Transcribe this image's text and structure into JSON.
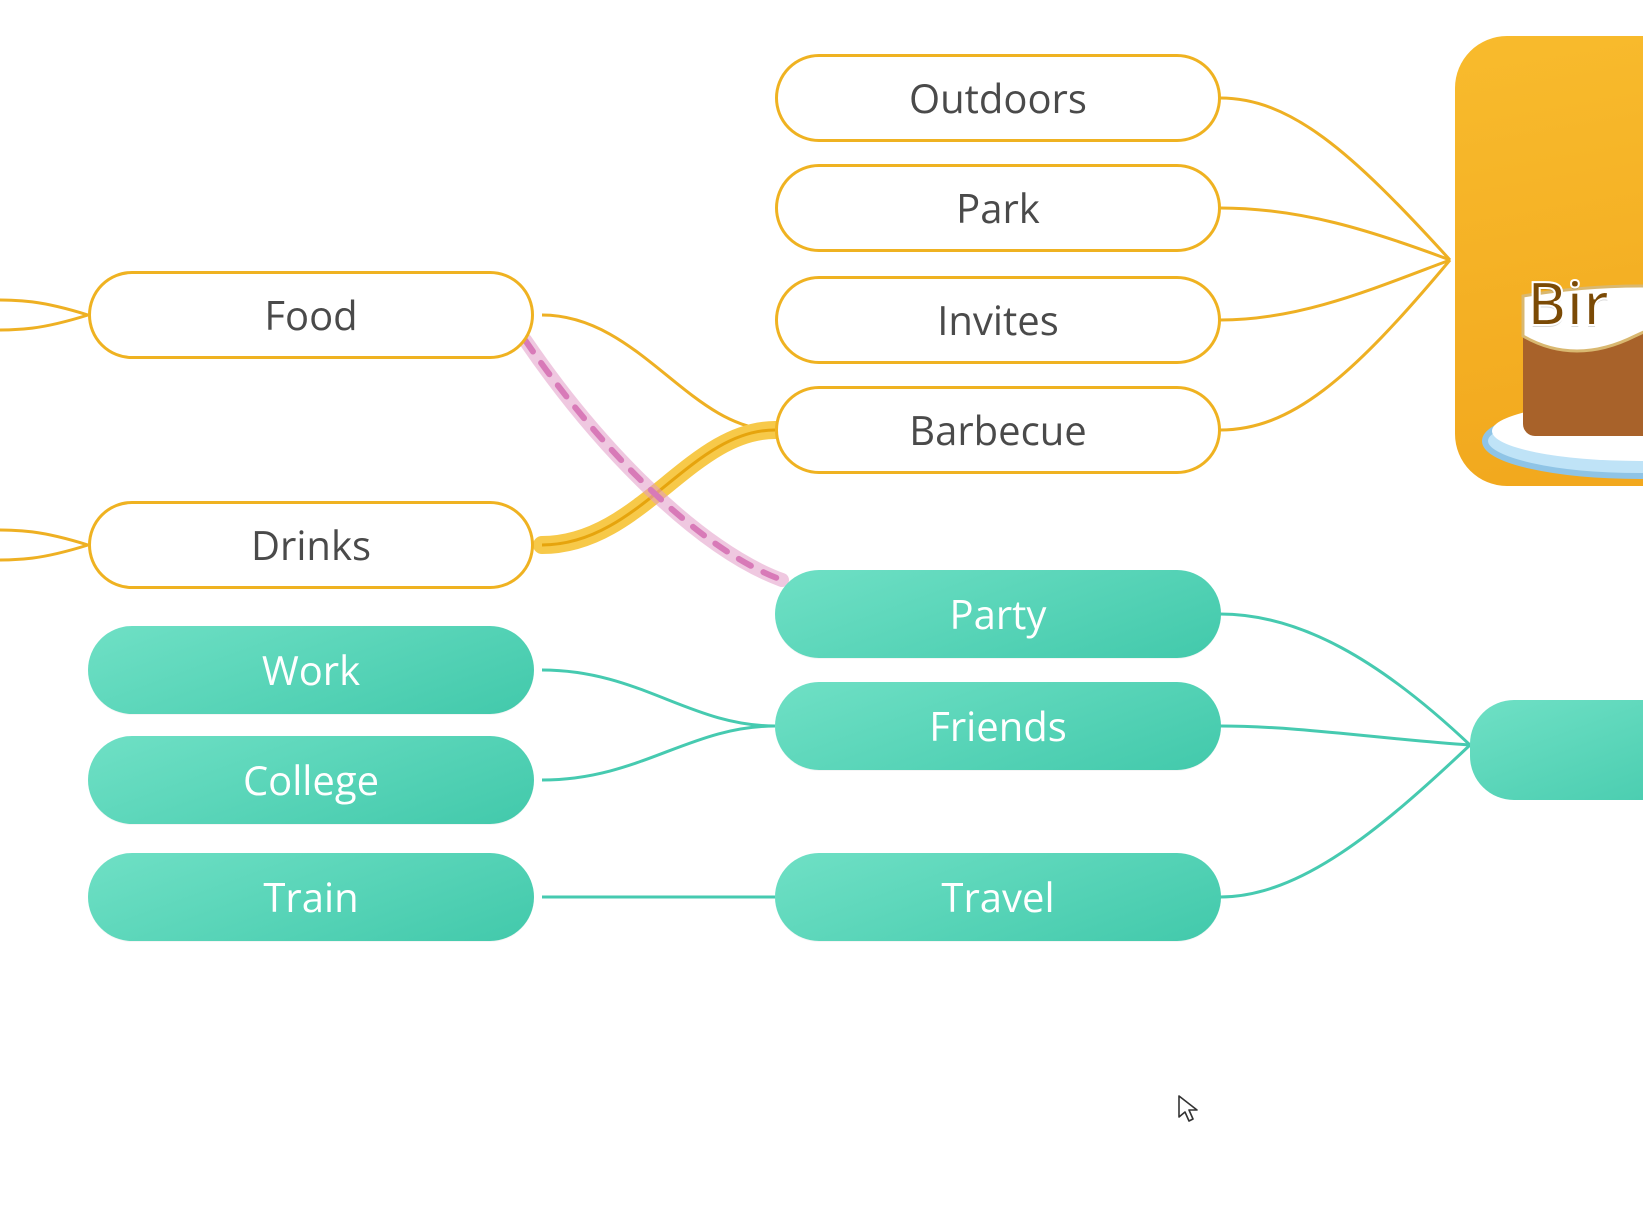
{
  "root": {
    "title": "Bir"
  },
  "orange_nodes": {
    "food": "Food",
    "drinks": "Drinks",
    "outdoors": "Outdoors",
    "park": "Park",
    "invites": "Invites",
    "barbecue": "Barbecue"
  },
  "teal_nodes": {
    "work": "Work",
    "college": "College",
    "train": "Train",
    "party": "Party",
    "friends": "Friends",
    "travel": "Travel"
  },
  "colors": {
    "orange_stroke": "#eeb023",
    "teal_stroke": "#46cab0",
    "highlight_yellow": "#f7c949",
    "highlight_pink": "#e19bc7"
  }
}
